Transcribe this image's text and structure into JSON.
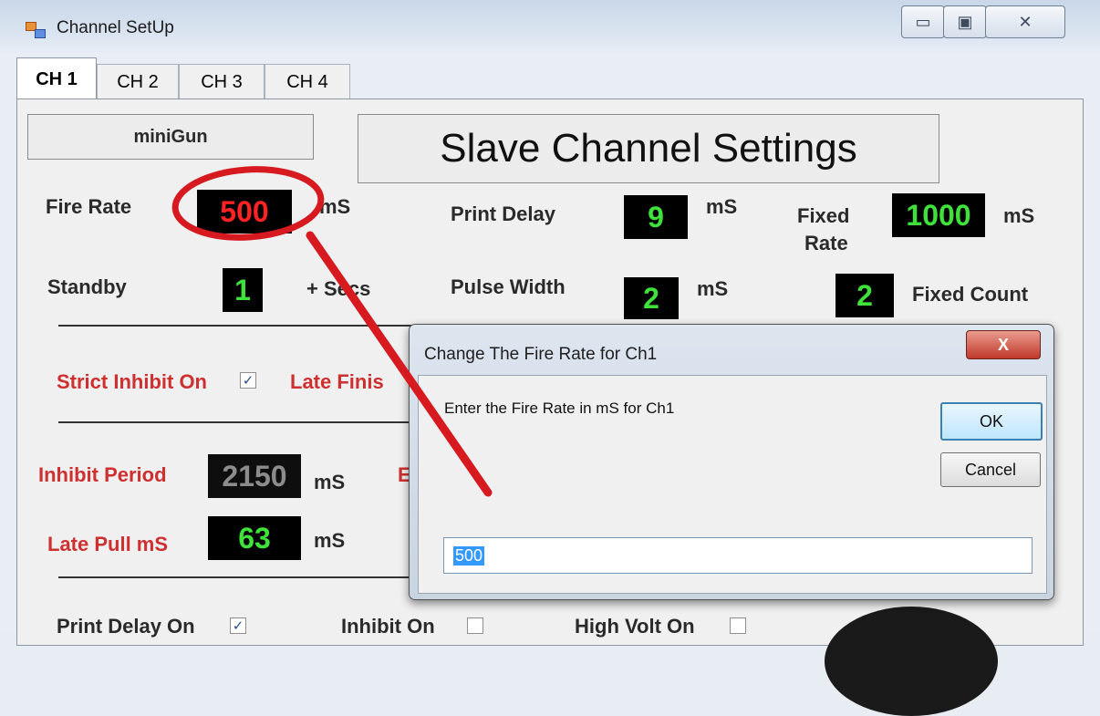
{
  "window": {
    "title": "Channel SetUp",
    "min_icon": "minimize-icon",
    "max_icon": "maximize-icon",
    "close_icon": "close-icon"
  },
  "tabs": [
    {
      "label": "CH 1"
    },
    {
      "label": "CH 2"
    },
    {
      "label": "CH 3"
    },
    {
      "label": "CH 4"
    }
  ],
  "panel": {
    "name_box": "miniGun",
    "heading": "Slave Channel Settings",
    "fire_rate": {
      "label": "Fire Rate",
      "value": "500",
      "unit": "mS"
    },
    "print_delay": {
      "label": "Print Delay",
      "value": "9",
      "unit": "mS"
    },
    "fixed_rate": {
      "label_line1": "Fixed",
      "label_line2": "Rate",
      "value": "1000",
      "unit": "mS"
    },
    "standby": {
      "label": "Standby",
      "value": "1",
      "unit": "+ Secs"
    },
    "pulse_width": {
      "label": "Pulse Width",
      "value": "2",
      "unit": "mS"
    },
    "fixed_count": {
      "label": "Fixed Count",
      "value": "2"
    },
    "strict_inhibit": {
      "label": "Strict Inhibit On",
      "checked": true
    },
    "late_finish": {
      "label": "Late Finis"
    },
    "inhibit_period": {
      "label": "Inhibit Period",
      "value": "2150",
      "unit": "mS",
      "trailing": "E"
    },
    "late_pull": {
      "label": "Late Pull mS",
      "value": "63",
      "unit": "mS"
    },
    "print_delay_on": {
      "label": "Print Delay On",
      "checked": true
    },
    "inhibit_on": {
      "label": "Inhibit On",
      "checked": false
    },
    "high_volt_on": {
      "label": "High Volt On",
      "checked": false
    }
  },
  "dialog": {
    "title": "Change The Fire Rate for   Ch1",
    "close_label": "X",
    "prompt": "Enter the Fire Rate in mS for Ch1",
    "ok_label": "OK",
    "cancel_label": "Cancel",
    "input_value": "500"
  },
  "colors": {
    "accent_red": "#cf2f2f",
    "lcd_green": "#3ee23a",
    "annotation": "#d71920"
  }
}
